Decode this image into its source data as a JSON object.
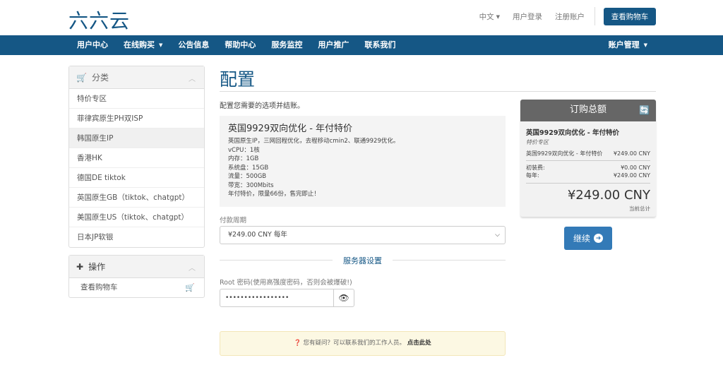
{
  "brand": {
    "logo_text": "六六云"
  },
  "top": {
    "language": "中文",
    "login": "用户登录",
    "register": "注册账户",
    "view_cart": "查看购物车"
  },
  "nav": {
    "items": [
      {
        "label": "用户中心"
      },
      {
        "label": "在线购买",
        "has_dropdown": true
      },
      {
        "label": "公告信息"
      },
      {
        "label": "帮助中心"
      },
      {
        "label": "服务监控"
      },
      {
        "label": "用户推广"
      },
      {
        "label": "联系我们"
      }
    ],
    "account": "账户管理"
  },
  "sidebar": {
    "categories_title": "分类",
    "categories": [
      {
        "label": "特价专区"
      },
      {
        "label": "菲律宾原生PH双ISP"
      },
      {
        "label": "韩国原生IP",
        "active": true
      },
      {
        "label": "香港HK"
      },
      {
        "label": "德国DE tiktok"
      },
      {
        "label": "英国原生GB（tiktok、chatgpt）"
      },
      {
        "label": "美国原生US（tiktok、chatgpt）"
      },
      {
        "label": "日本JP软银"
      }
    ],
    "actions_title": "操作",
    "view_cart": "查看购物车"
  },
  "main": {
    "title": "配置",
    "intro": "配置您需要的选项并结账。",
    "product": {
      "name": "英国9929双向优化 - 年付特价",
      "lines": [
        "英国原生IP，三网回程优化，去程移动cmin2、联通9929优化。",
        "vCPU：1核",
        "内存：1GB",
        "系统盘：15GB",
        "流量：500GB",
        "带宽：300Mbits",
        "年付特价，限量66份，售完即止！"
      ]
    },
    "billing_label": "付款周期",
    "billing_value": "¥249.00 CNY 每年",
    "server_section": "服务器设置",
    "root_label": "Root 密码(使用高强度密码，否则会被爆破!)",
    "root_value": "•••••••••••••••••",
    "help_text": "您有疑问？可以联系我们的工作人员。",
    "help_link": "点击此处"
  },
  "summary": {
    "title": "订购总额",
    "product_name": "英国9929双向优化 - 年付特价",
    "group": "特价专区",
    "line_label": "英国9929双向优化 - 年付特价",
    "line_value": "¥249.00 CNY",
    "setup_label": "初装费:",
    "setup_value": "¥0.00 CNY",
    "annual_label": "每年:",
    "annual_value": "¥249.00 CNY",
    "total": "¥249.00 CNY",
    "total_note": "当前总计",
    "continue": "继续"
  },
  "colors": {
    "brand": "#155785",
    "button": "#337ab7",
    "help_bg": "#fcf8e3"
  }
}
